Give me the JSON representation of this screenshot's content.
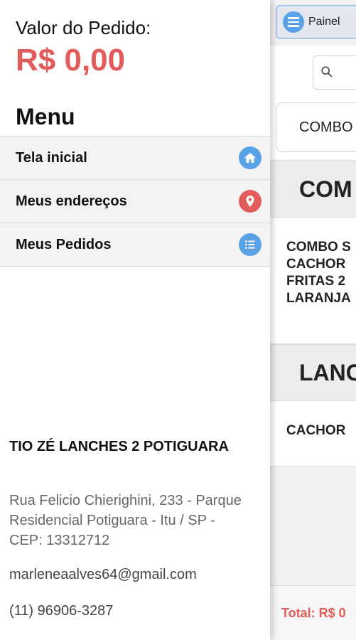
{
  "drawer": {
    "order_label": "Valor do Pedido:",
    "order_value": "R$ 0,00",
    "menu_heading": "Menu",
    "menu_items": [
      {
        "label": "Tela inicial",
        "icon": "home-icon",
        "color": "#5aa2e8"
      },
      {
        "label": "Meus endereços",
        "icon": "location-pin-icon",
        "color": "#e35c5c"
      },
      {
        "label": "Meus Pedidos",
        "icon": "list-icon",
        "color": "#5aa2e8"
      }
    ],
    "store": {
      "name": "TIO ZÉ LANCHES 2 POTIGUARA",
      "address": "Rua Felicio Chierighini, 233 - Parque Residencial Potiguara - Itu / SP - CEP: 13312712",
      "email": "marleneaalves64@gmail.com",
      "phone": "(11) 96906-3287"
    }
  },
  "main": {
    "painel_label": "Painel",
    "category_pill": "COMBO",
    "sections": [
      {
        "heading": "COM",
        "product": "COMBO S\nCACHOR\nFRITAS 2\nLARANJA"
      },
      {
        "heading": "LANC",
        "product": "CACHOR"
      }
    ],
    "total": "Total: R$ 0"
  },
  "colors": {
    "accent_red": "#e35c5c",
    "accent_blue": "#5aa2e8"
  }
}
